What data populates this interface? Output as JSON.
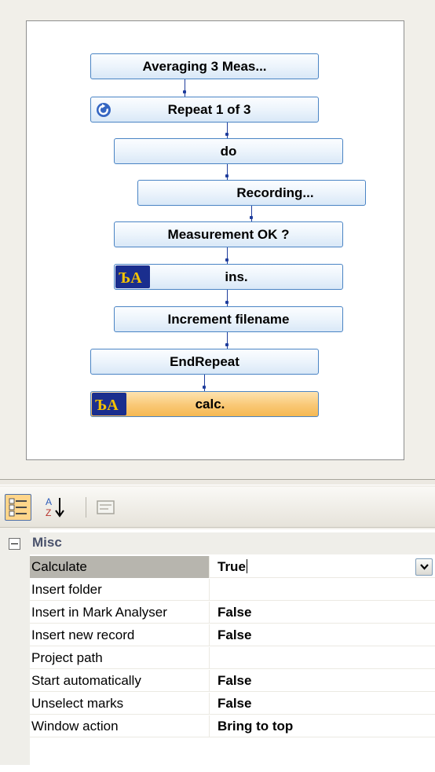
{
  "flow": {
    "nodes": [
      {
        "label": "Averaging 3 Meas...",
        "icon": null
      },
      {
        "label": "Repeat 1 of 3",
        "icon": "repeat-loop-icon"
      },
      {
        "label": "do",
        "icon": null
      },
      {
        "label": "Recording...",
        "icon": null
      },
      {
        "label": "Measurement OK ?",
        "icon": null
      },
      {
        "label": "ins.",
        "icon": "script-icon"
      },
      {
        "label": "Increment filename",
        "icon": null
      },
      {
        "label": "EndRepeat",
        "icon": null
      },
      {
        "label": "calc.",
        "icon": "script-icon",
        "selected": true
      }
    ],
    "script_icon_glyph": "ЪA"
  },
  "toolbar": {
    "categorized_icon": "categorized-view-icon",
    "alphabetical_icon": "sort-alphabetical-icon",
    "alphabetical_glyph": "A Z ↓",
    "property_pages_icon": "property-pages-icon"
  },
  "property_grid": {
    "category": "Misc",
    "properties": [
      {
        "name": "Calculate",
        "value": "True",
        "selected": true,
        "has_dropdown": true
      },
      {
        "name": "Insert folder",
        "value": ""
      },
      {
        "name": "Insert in Mark Analyser",
        "value": "False"
      },
      {
        "name": "Insert new record",
        "value": "False"
      },
      {
        "name": "Project path",
        "value": ""
      },
      {
        "name": "Start automatically",
        "value": "False"
      },
      {
        "name": "Unselect marks",
        "value": "False"
      },
      {
        "name": "Window action",
        "value": "Bring to top"
      }
    ]
  },
  "colors": {
    "node_border": "#4a84c4",
    "node_selected": "#f9c875",
    "connector": "#1f3d9c",
    "category_text": "#49516b"
  }
}
